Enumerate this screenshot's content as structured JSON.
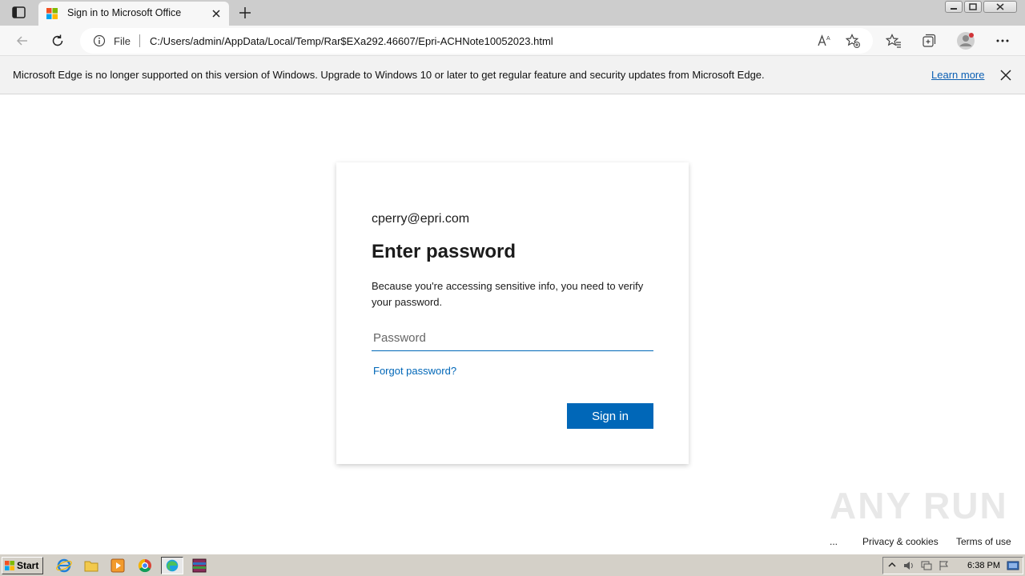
{
  "browser": {
    "tab_title": "Sign in to Microsoft Office",
    "scheme": "File",
    "url": "C:/Users/admin/AppData/Local/Temp/Rar$EXa292.46607/Epri-ACHNote10052023.html"
  },
  "infobar": {
    "message": "Microsoft Edge is no longer supported on this version of Windows. Upgrade to Windows 10 or later to get regular feature and security updates from Microsoft Edge.",
    "link": "Learn more"
  },
  "signin": {
    "email": "cperry@epri.com",
    "heading": "Enter password",
    "description": "Because you're accessing sensitive info, you need to verify your password.",
    "password_placeholder": "Password",
    "forgot": "Forgot password?",
    "button": "Sign in"
  },
  "footer": {
    "more": "...",
    "privacy": "Privacy & cookies",
    "terms": "Terms of use"
  },
  "watermark": "ANY RUN",
  "taskbar": {
    "start": "Start",
    "clock": "6:38 PM"
  },
  "colors": {
    "accent": "#0067b8",
    "tabbar": "#cdcdcd",
    "infobar": "#f2f2f2",
    "taskbar": "#d4d0c8"
  }
}
